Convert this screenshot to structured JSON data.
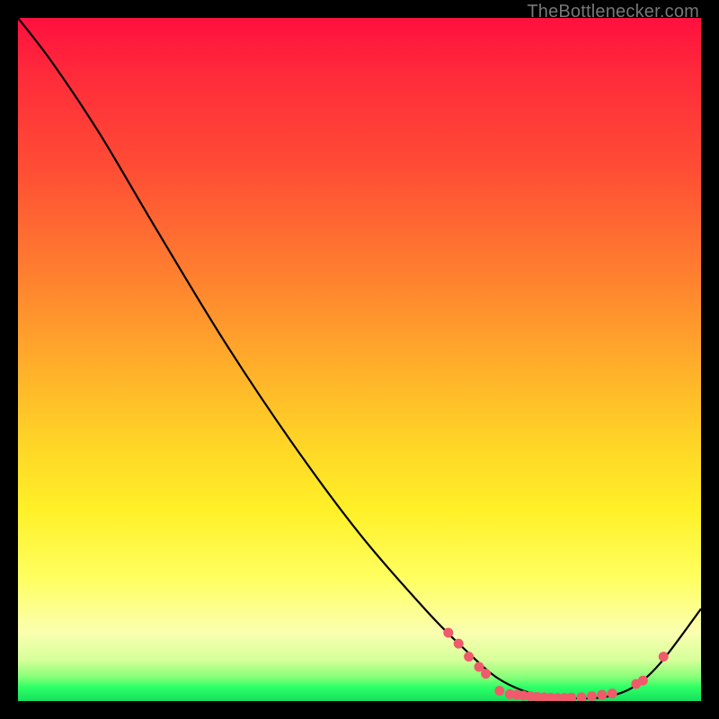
{
  "watermark": "TheBottlenecker.com",
  "colors": {
    "curve": "#000000",
    "dot_fill": "#ef5b6b",
    "dot_stroke": "#ef5b6b",
    "gradient_top": "#ff1040",
    "gradient_bottom": "#17e05d"
  },
  "chart_data": {
    "type": "line",
    "title": "",
    "xlabel": "",
    "ylabel": "",
    "xlim": [
      0,
      100
    ],
    "ylim": [
      0,
      100
    ],
    "grid": false,
    "legend": false,
    "curve_points_xy": [
      [
        0.0,
        100.0
      ],
      [
        5.0,
        93.5
      ],
      [
        12.0,
        83.0
      ],
      [
        20.0,
        69.5
      ],
      [
        30.0,
        53.0
      ],
      [
        40.0,
        38.0
      ],
      [
        50.0,
        24.5
      ],
      [
        60.0,
        13.0
      ],
      [
        66.0,
        7.0
      ],
      [
        70.0,
        3.5
      ],
      [
        74.0,
        1.5
      ],
      [
        78.0,
        0.6
      ],
      [
        82.0,
        0.4
      ],
      [
        86.0,
        0.6
      ],
      [
        90.0,
        2.0
      ],
      [
        94.0,
        5.5
      ],
      [
        100.0,
        13.5
      ]
    ],
    "data_dots_xy": [
      [
        63.0,
        10.0
      ],
      [
        64.5,
        8.4
      ],
      [
        66.0,
        6.5
      ],
      [
        67.5,
        5.0
      ],
      [
        68.5,
        4.0
      ],
      [
        70.5,
        1.5
      ],
      [
        72.0,
        1.0
      ],
      [
        73.0,
        0.9
      ],
      [
        74.0,
        0.8
      ],
      [
        75.0,
        0.7
      ],
      [
        76.0,
        0.6
      ],
      [
        77.0,
        0.55
      ],
      [
        78.0,
        0.5
      ],
      [
        79.0,
        0.45
      ],
      [
        80.0,
        0.45
      ],
      [
        81.0,
        0.5
      ],
      [
        82.5,
        0.55
      ],
      [
        84.0,
        0.7
      ],
      [
        85.5,
        0.9
      ],
      [
        87.0,
        1.1
      ],
      [
        90.5,
        2.5
      ],
      [
        91.5,
        3.0
      ],
      [
        94.5,
        6.5
      ]
    ]
  }
}
